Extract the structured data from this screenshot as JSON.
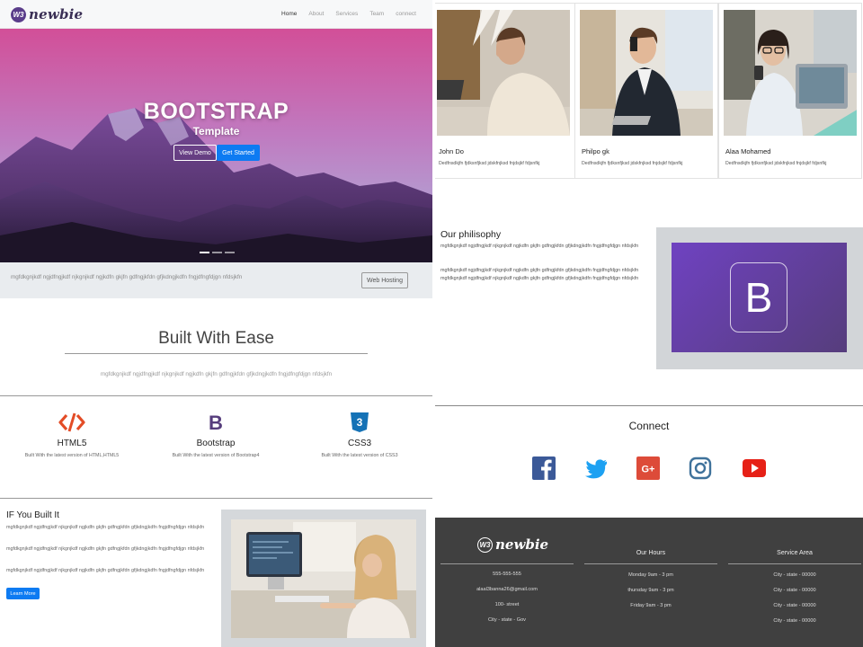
{
  "brand": {
    "badge": "W3",
    "name": "newbie"
  },
  "nav": {
    "links": [
      "Home",
      "About",
      "Services",
      "Team",
      "connect"
    ]
  },
  "hero": {
    "title": "BOOTSTRAP",
    "subtitle": "Template",
    "btn_demo": "View Demo",
    "btn_start": "Get Started"
  },
  "graybar": {
    "text": "mgfdkgnjkdf ngjdfngjkdf njkgnjkdf ngjkdfn gkjfn gdfngjkfdn gfjkdngjkdfn fngjdfngfdjgn nfdsjkfn",
    "button": "Web Hosting"
  },
  "built": {
    "title": "Built With Ease",
    "text": "mgfdkgnjkdf ngjdfngjkdf njkgnjkdf ngjkdfn gkjfn gdfngjkfdn gfjkdngjkdfn fngjdfngfdjgn nfdsjkfn"
  },
  "tech": [
    {
      "name": "HTML5",
      "desc": "Built With the latest version of HTML,HTML5"
    },
    {
      "name": "Bootstrap",
      "desc": "Built With the latest version of Bootstrap4"
    },
    {
      "name": "CSS3",
      "desc": "Built With the latest version of CSS3"
    }
  ],
  "iybi": {
    "title": "IF You Built It",
    "paragraphs": [
      "mgfdkgnjkdf ngjdfngjkdf njkgnjkdf ngjkdfn gkjfn gdfngjkfdn gfjkdngjkdfn fngjdfngfdjgn nfdsjkfn",
      "mgfdkgnjkdf ngjdfngjkdf njkgnjkdf ngjkdfn gkjfn gdfngjkfdn gfjkdngjkdfn fngjdfngfdjgn nfdsjkfn",
      "mgfdkgnjkdf ngjdfngjkdf njkgnjkdf ngjkdfn gkjfn gdfngjkfdn gfjkdngjkdfn fngjdfngfdjgn nfdsjkfn"
    ],
    "button": "Learn More"
  },
  "team": [
    {
      "name": "John Do",
      "desc": "Dedfnsdkjfn fjdksnfjksd jdskfnjksd fnjdsjkf fdjsnfkj"
    },
    {
      "name": "Philpo gk",
      "desc": "Dedfnsdkjfn fjdksnfjksd jdskfnjksd fnjdsjkf fdjsnfkj"
    },
    {
      "name": "Alaa Mohamed",
      "desc": "Dedfnsdkjfn fjdksnfjksd jdskfnjksd fnjdsjkf fdjsnfkj"
    }
  ],
  "philosophy": {
    "title": "Our philisophy",
    "paragraphs": [
      "mgfdkgnjkdf ngjdfngjkdf njkgnjkdf ngjkdfn gkjfn gdfngjkfdn gfjkdngjkdfn fngjdfngfdjgn nfdsjkfn",
      "mgfdkgnjkdf ngjdfngjkdf njkgnjkdf ngjkdfn gkjfn gdfngjkfdn gfjkdngjkdfn fngjdfngfdjgn nfdsjkfn mgfdkgnjkdf ngjdfngjkdf njkgnjkdf ngjkdfn gkjfn gdfngjkfdn gfjkdngjkdfn fngjdfngfdjgn nfdsjkfn"
    ],
    "logo_letter": "B"
  },
  "connect": {
    "title": "Connect",
    "icons": [
      "facebook-icon",
      "twitter-icon",
      "google-plus-icon",
      "instagram-icon",
      "youtube-icon"
    ],
    "google_label": "G+",
    "colors": {
      "facebook": "#3b5998",
      "twitter": "#1da1f2",
      "google": "#dd4b39",
      "instagram": "#3f729b",
      "youtube": "#e62117"
    }
  },
  "footer": {
    "contact": [
      "555-555-555",
      "alaal3banna26@gmail.com",
      "100- street",
      "City - state - Gov"
    ],
    "hours_title": "Our Hours",
    "hours": [
      "Monday 9am - 3 pm",
      "thursday 9am - 3 pm",
      "Friday 9am - 3 pm"
    ],
    "area_title": "Service Area",
    "areas": [
      "City - state - 00000",
      "City - state - 00000",
      "City - state - 00000",
      "City - state - 00000"
    ]
  },
  "colors": {
    "primary": "#0d7bf2",
    "footer_bg": "#404040",
    "bootstrap_purple": "#563d7c"
  }
}
